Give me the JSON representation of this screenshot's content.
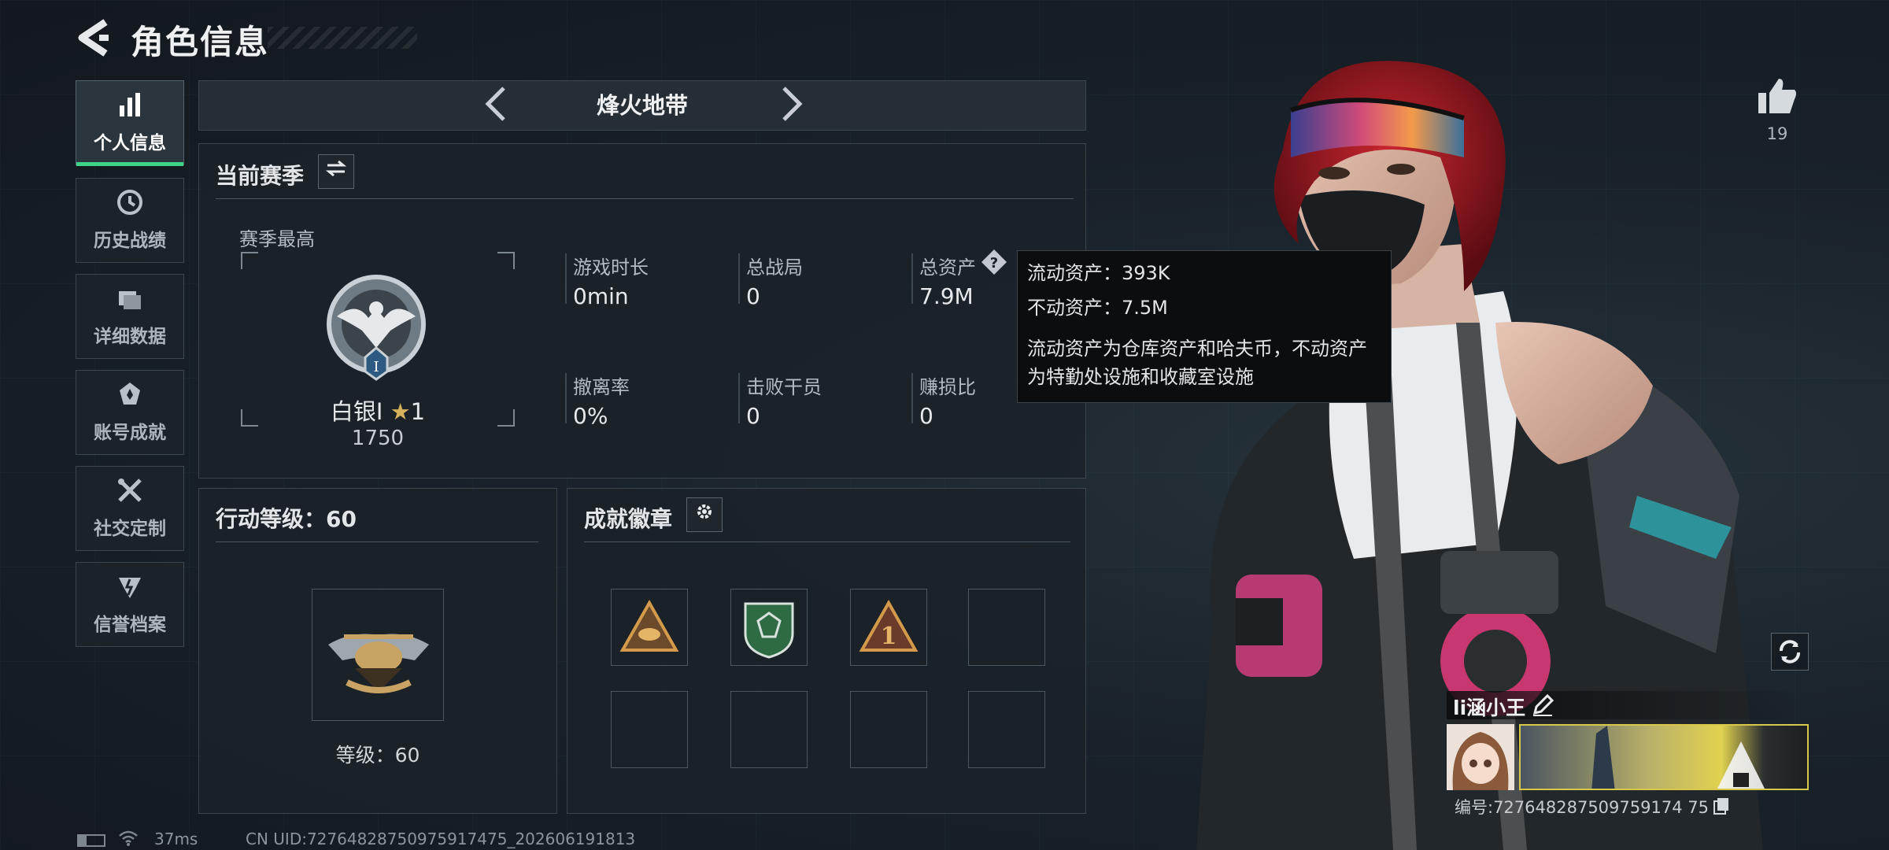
{
  "header": {
    "title": "角色信息"
  },
  "nav": [
    {
      "label": "个人信息",
      "icon": "bar-chart-icon",
      "active": true
    },
    {
      "label": "历史战绩",
      "icon": "history-clock-icon"
    },
    {
      "label": "详细数据",
      "icon": "folder-icon"
    },
    {
      "label": "账号成就",
      "icon": "achievement-icon"
    },
    {
      "label": "社交定制",
      "icon": "tools-icon"
    },
    {
      "label": "信誉档案",
      "icon": "credit-shield-icon"
    }
  ],
  "mode": {
    "title": "烽火地带"
  },
  "season": {
    "title": "当前赛季",
    "best_label": "赛季最高",
    "rank_name": "白银I",
    "rank_stars": "1",
    "rank_score": "1750",
    "stats": [
      {
        "label": "游戏时长",
        "value": "0min"
      },
      {
        "label": "总战局",
        "value": "0"
      },
      {
        "label": "总资产",
        "value": "7.9M"
      },
      {
        "label": "撤离率",
        "value": "0%"
      },
      {
        "label": "击败干员",
        "value": "0"
      },
      {
        "label": "赚损比",
        "value": "0"
      }
    ]
  },
  "tooltip": {
    "liquid": "流动资产：393K",
    "fixed": "不动资产：7.5M",
    "desc_line1": "流动资产为仓库资产和哈夫币，不动资产",
    "desc_line2": "为特勤处设施和收藏室设施"
  },
  "action_level": {
    "title": "行动等级：60",
    "level_text": "等级：60"
  },
  "achievements": {
    "title": "成就徽章"
  },
  "likes": {
    "count": "19"
  },
  "player": {
    "name": "li涵小王",
    "id_text": "编号:727648287509759174 75"
  },
  "footer": {
    "ping": "37ms",
    "uid": "CN UID:72764828750975917475_202606191813"
  },
  "colors": {
    "accent_green": "#3fd38a",
    "tooltip_bg": "#0b0d0f",
    "hair_red": "#a01a22"
  }
}
